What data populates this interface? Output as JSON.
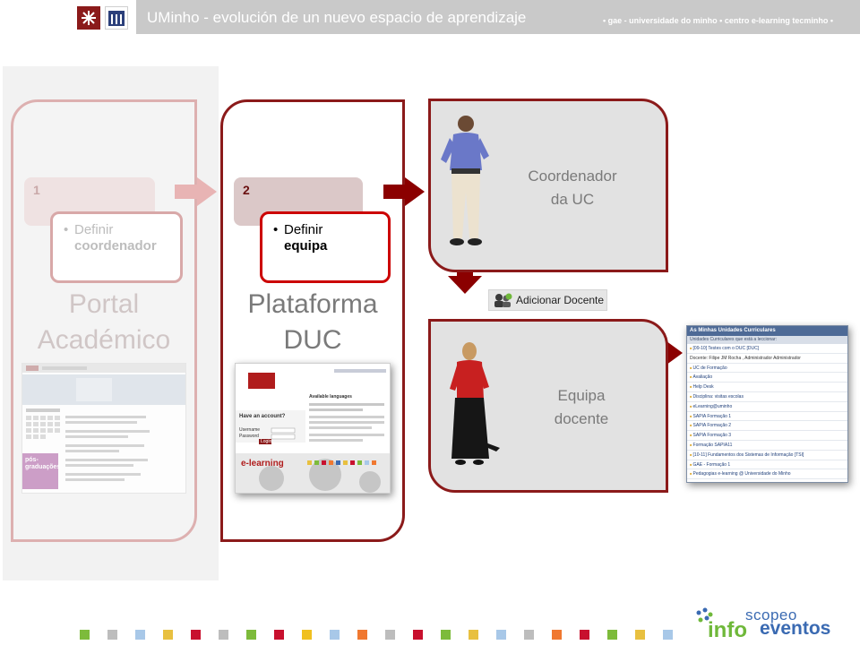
{
  "header": {
    "title": "UMinho - evolución de un nuevo espacio de aprendizaje",
    "subtitle": "• gae - universidade do minho • centro e-learning tecminho •"
  },
  "columns": [
    {
      "step": "1",
      "bullet": "•",
      "task_line1": "Definir",
      "task_line2": "coordenador",
      "title_line1": "Portal",
      "title_line2": "Académico",
      "thumb_caption": "pós-graduações"
    },
    {
      "step": "2",
      "bullet": "•",
      "task_line1": "Definir",
      "task_line2": "equipa",
      "title_line1": "Plataforma",
      "title_line2": "DUC",
      "thumb": {
        "form_title": "Have an account?",
        "username_label": "Username",
        "password_label": "Password",
        "login_button": "Login",
        "brand": "e-learning",
        "languages_title": "Available languages"
      }
    }
  ],
  "roles": [
    {
      "line1": "Coordenador",
      "line2": "da UC"
    },
    {
      "line1": "Equipa",
      "line2": "docente"
    }
  ],
  "add_button": "Adicionar Docente",
  "uc_panel": {
    "title": "As Minhas Unidades Curriculares",
    "subtitle": "Unidades Curriculares que está a leccionar:",
    "items": [
      "[09-10] Testes com o DUC [DUC]",
      "Docente: Filipe JM Rocha , Administrador Administrador",
      "UC de Formação",
      "Avaliação",
      "Help Desk",
      "Disciplina: visitas escolas",
      "eLearning@uminho",
      "SAPIA Formação 1",
      "SAPIA Formação 2",
      "SAPIA Formação 3",
      "Formação SAPIA11",
      "[10-11] Fundamentos dos Sistemas de Informação [TSI]",
      "GAE - Formação 1",
      "Pedagogias e-learning @ Universidade do Minho"
    ]
  },
  "footer": {
    "logo_scopeo": "scopeo",
    "logo_info": "info",
    "logo_eventos": "eventos",
    "square_colors": [
      "#7dbb3b",
      "#bdbdbd",
      "#a8c8e8",
      "#e8c040",
      "#c8102e",
      "#bdbdbd",
      "#7dbb3b",
      "#c8102e",
      "#f0c020",
      "#a8c8e8",
      "#f07830",
      "#bdbdbd",
      "#c8102e",
      "#7dbb3b",
      "#e8c040",
      "#a8c8e8",
      "#bdbdbd",
      "#f07830",
      "#c8102e",
      "#7dbb3b",
      "#e8c040",
      "#a8c8e8"
    ]
  },
  "colors": {
    "accent": "#8b1a1a",
    "arrow": "#8b0000",
    "arrow_faded": "#e8b4b4",
    "highlight": "#cc0000"
  }
}
